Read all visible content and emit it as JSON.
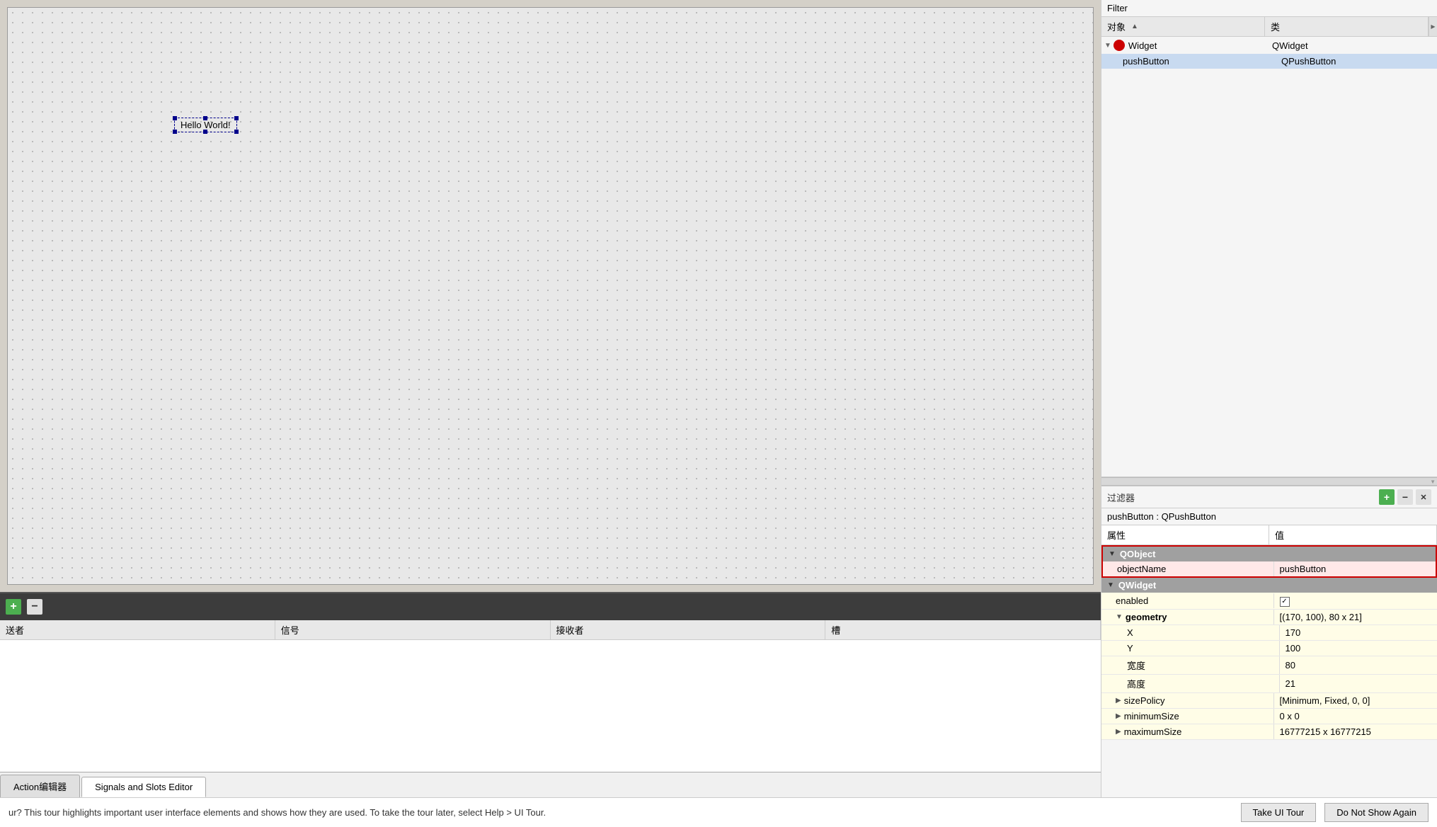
{
  "filter": {
    "label": "Filter",
    "filter_label_zh": "过滤器"
  },
  "object_inspector": {
    "columns": [
      {
        "label": "对象",
        "sort_arrow": "▲"
      },
      {
        "label": "类"
      }
    ],
    "rows": [
      {
        "indent": 0,
        "expanded": true,
        "name": "Widget",
        "class": "QWidget",
        "has_icon": true,
        "selected": false
      },
      {
        "indent": 1,
        "expanded": false,
        "name": "pushButton",
        "class": "QPushButton",
        "has_icon": false,
        "selected": true
      }
    ]
  },
  "canvas": {
    "widget_label": "Hello World!"
  },
  "properties_panel": {
    "filter_label": "过滤器",
    "title": "pushButton : QPushButton",
    "columns": [
      {
        "label": "属性"
      },
      {
        "label": "值"
      }
    ],
    "groups": [
      {
        "name": "QObject",
        "expanded": true,
        "rows": [
          {
            "name": "objectName",
            "value": "pushButton",
            "highlighted": true
          }
        ]
      },
      {
        "name": "QWidget",
        "expanded": true,
        "rows": [
          {
            "name": "enabled",
            "value": "✓",
            "is_checkbox": true
          },
          {
            "name": "geometry",
            "value": "[(170, 100), 80 x 21]",
            "expandable": true,
            "expanded": true
          },
          {
            "name": "X",
            "value": "170",
            "indent": true
          },
          {
            "name": "Y",
            "value": "100",
            "indent": true
          },
          {
            "name": "宽度",
            "value": "80",
            "indent": true
          },
          {
            "name": "高度",
            "value": "21",
            "indent": true
          },
          {
            "name": "sizePolicy",
            "value": "[Minimum, Fixed, 0, 0]",
            "expandable": true
          },
          {
            "name": "minimumSize",
            "value": "0 x 0",
            "expandable": true
          },
          {
            "name": "maximumSize",
            "value": "16777215 x 16777215",
            "expandable": true
          }
        ]
      }
    ],
    "toolbar_buttons": [
      "+",
      "−",
      "🔧"
    ]
  },
  "signals_slots": {
    "toolbar_plus": "+",
    "toolbar_minus": "−",
    "columns": [
      "送者",
      "信号",
      "接收者",
      "槽"
    ]
  },
  "tabs": [
    {
      "label": "Action编辑器",
      "active": false
    },
    {
      "label": "Signals and Slots Editor",
      "active": true
    }
  ],
  "tour_bar": {
    "text": "ur? This tour highlights important user interface elements and shows how they are used. To take the tour later, select Help > UI Tour.",
    "btn_take": "Take UI Tour",
    "btn_no_show": "Do Not Show Again"
  }
}
